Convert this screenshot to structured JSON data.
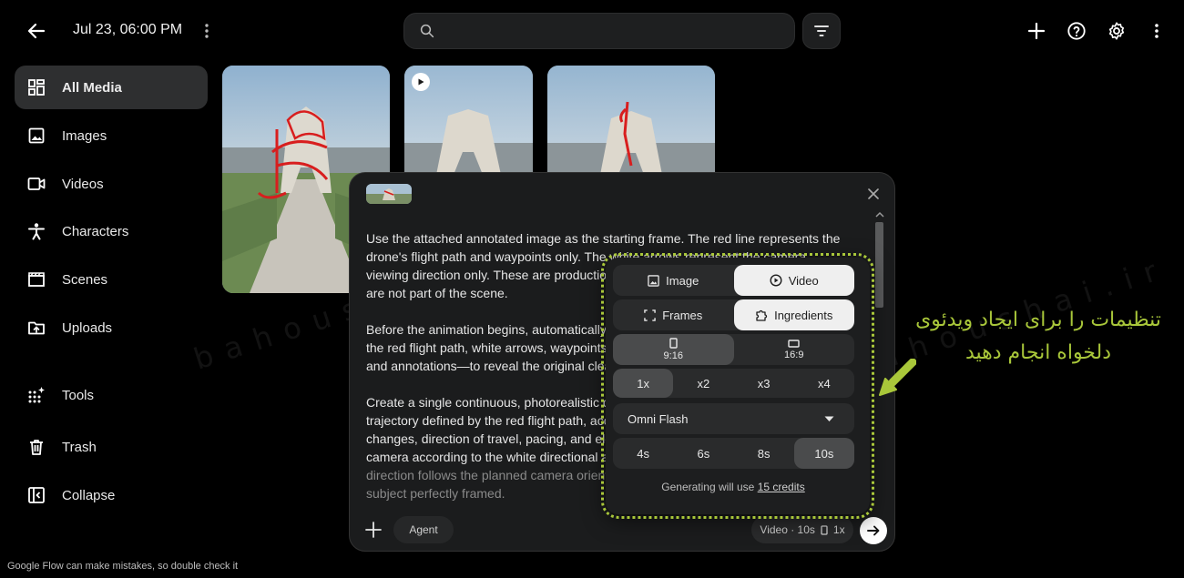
{
  "header": {
    "date": "Jul 23, 06:00 PM",
    "search_value": ""
  },
  "sidebar": {
    "items": [
      {
        "label": "All Media",
        "icon": "grid-icon",
        "active": true
      },
      {
        "label": "Images",
        "icon": "image-icon"
      },
      {
        "label": "Videos",
        "icon": "video-camera-icon"
      },
      {
        "label": "Characters",
        "icon": "person-icon"
      },
      {
        "label": "Scenes",
        "icon": "clapperboard-icon"
      },
      {
        "label": "Uploads",
        "icon": "upload-folder-icon"
      },
      {
        "label": "Tools",
        "icon": "sparkle-grid-icon"
      },
      {
        "label": "Trash",
        "icon": "trash-icon"
      },
      {
        "label": "Collapse",
        "icon": "collapse-sidebar-icon"
      }
    ]
  },
  "prompt": {
    "paragraphs": [
      "Use the attached annotated image as the starting frame. The red line represents the drone's flight path and waypoints only. The white arrows represent the camera viewing direction only. These are production markers and are not part of the scene.",
      "Before the animation begins, automatically remove all drone planning markers—the red flight path, white arrows, waypoints and annotations—to reveal the original clean image.",
      "Create a single continuous, photorealistic drone shot following the trajectory defined by the red flight path, accurately reproducing its altitude changes, direction of travel, pacing, and elevation. Continuously orient the camera according to the white directional arrows so that the viewing direction follows the planned camera orientation while keeping the subject perfectly framed."
    ],
    "visible_lines_p1": [
      "Use the attached annotated image as the starting frame. The red line represents the",
      "drone's flight path and waypoints only. The white arrows represent the camera",
      "viewing direction only. These are production markers and",
      "are not part of the scene."
    ],
    "visible_lines_p2": [
      "Before the animation begins, automatically remove all drone",
      "the red flight path, white arrows, waypoints",
      "and annotations—to reveal the original clean"
    ],
    "visible_lines_p3": [
      "Create a single continuous, photorealistic drone shot following",
      "trajectory defined by the red flight path, accurately",
      "changes, direction of travel, pacing, and elevation",
      "camera according to the white directional arrows",
      "direction follows the planned camera orientation",
      "subject perfectly framed."
    ],
    "agent_label": "Agent",
    "summary_mode": "Video · 10s",
    "summary_count": "1x"
  },
  "settings": {
    "type_options": [
      {
        "label": "Image",
        "selected": false
      },
      {
        "label": "Video",
        "selected": true
      }
    ],
    "source_options": [
      {
        "label": "Frames",
        "selected": false
      },
      {
        "label": "Ingredients",
        "selected": true
      }
    ],
    "aspect_options": [
      {
        "label": "9:16",
        "selected": true
      },
      {
        "label": "16:9",
        "selected": false
      }
    ],
    "count_options": [
      {
        "label": "1x",
        "selected": true
      },
      {
        "label": "x2"
      },
      {
        "label": "x3"
      },
      {
        "label": "x4"
      }
    ],
    "model": "Omni Flash",
    "duration_options": [
      {
        "label": "4s"
      },
      {
        "label": "6s"
      },
      {
        "label": "8s"
      },
      {
        "label": "10s",
        "selected": true
      }
    ],
    "credits_prefix": "Generating will use",
    "credits_link": "15 credits"
  },
  "annotation": {
    "line1": "تنظیمات را برای ایجاد ویدئوی",
    "line2": "دلخواه انجام دهید",
    "color": "#a9c73a"
  },
  "watermark": "bahoushai.ir",
  "footer": "Google Flow can make mistakes, so double check it"
}
